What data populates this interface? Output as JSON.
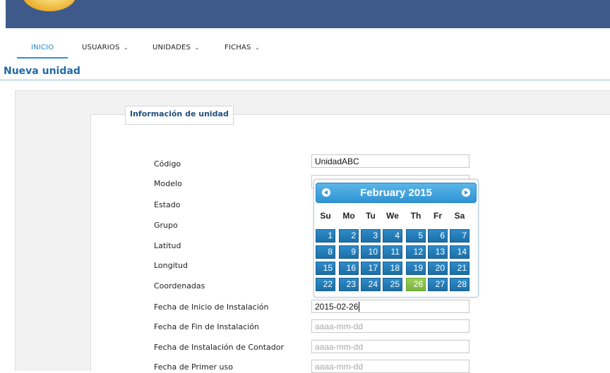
{
  "nav": {
    "items": [
      {
        "label": "INICIO",
        "active": true
      },
      {
        "label": "USUARIOS",
        "has_dropdown": true
      },
      {
        "label": "UNIDADES",
        "has_dropdown": true
      },
      {
        "label": "FICHAS",
        "has_dropdown": true
      }
    ]
  },
  "page": {
    "title": "Nueva unidad"
  },
  "form": {
    "legend": "Información de unidad",
    "fields": [
      {
        "label": "Código",
        "value": "UnidadABC",
        "placeholder": ""
      },
      {
        "label": "Modelo",
        "value": "",
        "placeholder": ""
      },
      {
        "label": "Estado",
        "value": "",
        "placeholder": ""
      },
      {
        "label": "Grupo",
        "value": "",
        "placeholder": ""
      },
      {
        "label": "Latitud",
        "value": "",
        "placeholder": ""
      },
      {
        "label": "Longitud",
        "value": "",
        "placeholder": ""
      },
      {
        "label": "Coordenadas",
        "value": "",
        "placeholder": ""
      },
      {
        "label": "Fecha de Inicio de Instalación",
        "value": "2015-02-26",
        "placeholder": ""
      },
      {
        "label": "Fecha de Fin de Instalación",
        "value": "",
        "placeholder": "aaaa-mm-dd"
      },
      {
        "label": "Fecha de Instalación de Contador",
        "value": "",
        "placeholder": "aaaa-mm-dd"
      },
      {
        "label": "Fecha de Primer uso",
        "value": "",
        "placeholder": "aaaa-mm-dd"
      }
    ]
  },
  "datepicker": {
    "title": "February 2015",
    "weekdays": [
      "Su",
      "Mo",
      "Tu",
      "We",
      "Th",
      "Fr",
      "Sa"
    ],
    "weeks": [
      [
        "1",
        "2",
        "3",
        "4",
        "5",
        "6",
        "7"
      ],
      [
        "8",
        "9",
        "10",
        "11",
        "12",
        "13",
        "14"
      ],
      [
        "15",
        "16",
        "17",
        "18",
        "19",
        "20",
        "21"
      ],
      [
        "22",
        "23",
        "24",
        "25",
        "26",
        "27",
        "28"
      ]
    ],
    "selected_day": "26",
    "prev_icon": "circle-arrow-left-icon",
    "next_icon": "circle-arrow-right-icon"
  },
  "colors": {
    "topbar": "#3d5a8a",
    "accent": "#1c86c9",
    "title": "#1f6aa8",
    "day_cell": "#1b6fa6",
    "day_selected": "#78b33a"
  },
  "icons": {
    "logo": "logo-sun",
    "dropdown": "chevron-down-icon"
  }
}
